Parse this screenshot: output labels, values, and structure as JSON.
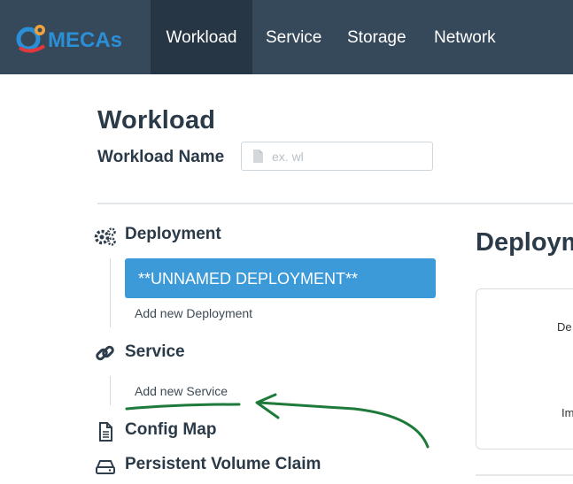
{
  "app": {
    "brand_text": "MECAs",
    "brand_colors": {
      "blue": "#2b8fd6",
      "orange": "#f2a23a",
      "red": "#e0383b"
    }
  },
  "nav": {
    "items": [
      {
        "label": "Workload",
        "active": true
      },
      {
        "label": "Service",
        "active": false
      },
      {
        "label": "Storage",
        "active": false
      },
      {
        "label": "Network",
        "active": false
      }
    ]
  },
  "workload": {
    "title": "Workload",
    "name_label": "Workload Name",
    "name_placeholder": "ex. wl",
    "name_value": ""
  },
  "sidebar": {
    "deployment": {
      "label": "Deployment",
      "icon": "gears-icon",
      "items": [
        "**UNNAMED DEPLOYMENT**"
      ],
      "add_label": "Add new Deployment"
    },
    "service": {
      "label": "Service",
      "icon": "link-icon",
      "add_label": "Add new Service"
    },
    "config_map": {
      "label": "Config Map",
      "icon": "file-icon"
    },
    "pvc": {
      "label": "Persistent Volume Claim",
      "icon": "hdd-icon"
    }
  },
  "detail": {
    "title": "Deployment",
    "field_fragments": [
      "De",
      "Im"
    ]
  },
  "colors": {
    "navbar": "#35495a",
    "nav_active": "#263644",
    "selected_item": "#3d9ad9",
    "annotation": "#1e7a3a"
  }
}
